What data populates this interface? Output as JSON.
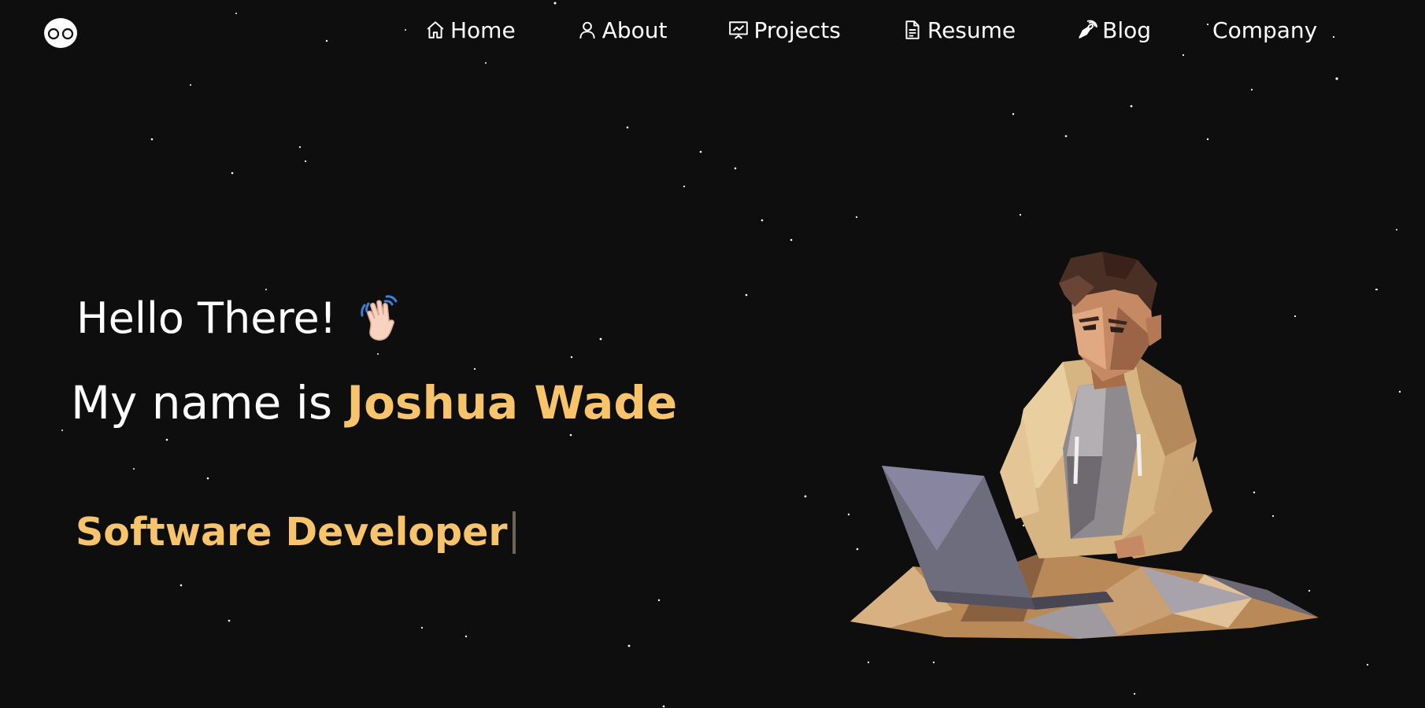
{
  "nav": {
    "logo_icon": "owl-eyes-logo-icon",
    "items": [
      {
        "label": "Home",
        "icon": "home-icon"
      },
      {
        "label": "About",
        "icon": "user-icon"
      },
      {
        "label": "Projects",
        "icon": "presentation-chart-icon"
      },
      {
        "label": "Resume",
        "icon": "document-icon"
      },
      {
        "label": "Blog",
        "icon": "pen-nib-icon"
      },
      {
        "label": "Company",
        "icon": ""
      }
    ]
  },
  "hero": {
    "greeting": "Hello There!",
    "greeting_icon": "waving-hand-icon",
    "name_prefix": "My name is ",
    "name": "Joshua Wade",
    "role": "Software Developer",
    "accent_color": "#f7c46c",
    "illustration_icon": "developer-with-laptop-illustration"
  }
}
